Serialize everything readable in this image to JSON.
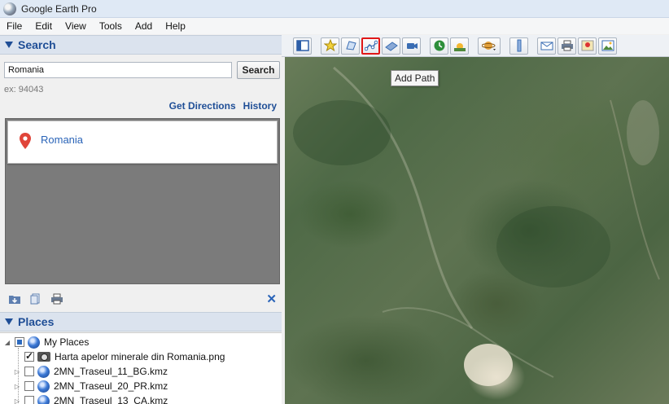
{
  "window": {
    "title": "Google Earth Pro"
  },
  "menu": [
    "File",
    "Edit",
    "View",
    "Tools",
    "Add",
    "Help"
  ],
  "search": {
    "header": "Search",
    "input_value": "Romania",
    "button_label": "Search",
    "hint": "ex: 94043",
    "get_directions": "Get Directions",
    "history": "History",
    "result": "Romania"
  },
  "panel_tools": {
    "close": "✕"
  },
  "places": {
    "header": "Places",
    "items": [
      {
        "label": "My Places"
      },
      {
        "label": "Harta apelor minerale din Romania.png"
      },
      {
        "label": "2MN_Traseul_11_BG.kmz"
      },
      {
        "label": "2MN_Traseul_20_PR.kmz"
      },
      {
        "label": "2MN_Traseul_13_CA.kmz"
      }
    ]
  },
  "toolbar": {
    "buttons": [
      {
        "icon": "sidebar-toggle-icon"
      },
      {
        "icon": "placemark-add-icon"
      },
      {
        "icon": "polygon-add-icon"
      },
      {
        "icon": "path-add-icon"
      },
      {
        "icon": "image-overlay-add-icon"
      },
      {
        "icon": "tour-record-icon"
      },
      {
        "icon": "historical-imagery-icon"
      },
      {
        "icon": "sunlight-icon"
      },
      {
        "icon": "planets-icon"
      },
      {
        "icon": "ruler-icon"
      },
      {
        "icon": "email-icon"
      },
      {
        "icon": "print-icon"
      },
      {
        "icon": "view-in-maps-icon"
      },
      {
        "icon": "save-image-icon"
      }
    ],
    "highlight_color": "#e01818"
  },
  "tooltip": "Add Path"
}
